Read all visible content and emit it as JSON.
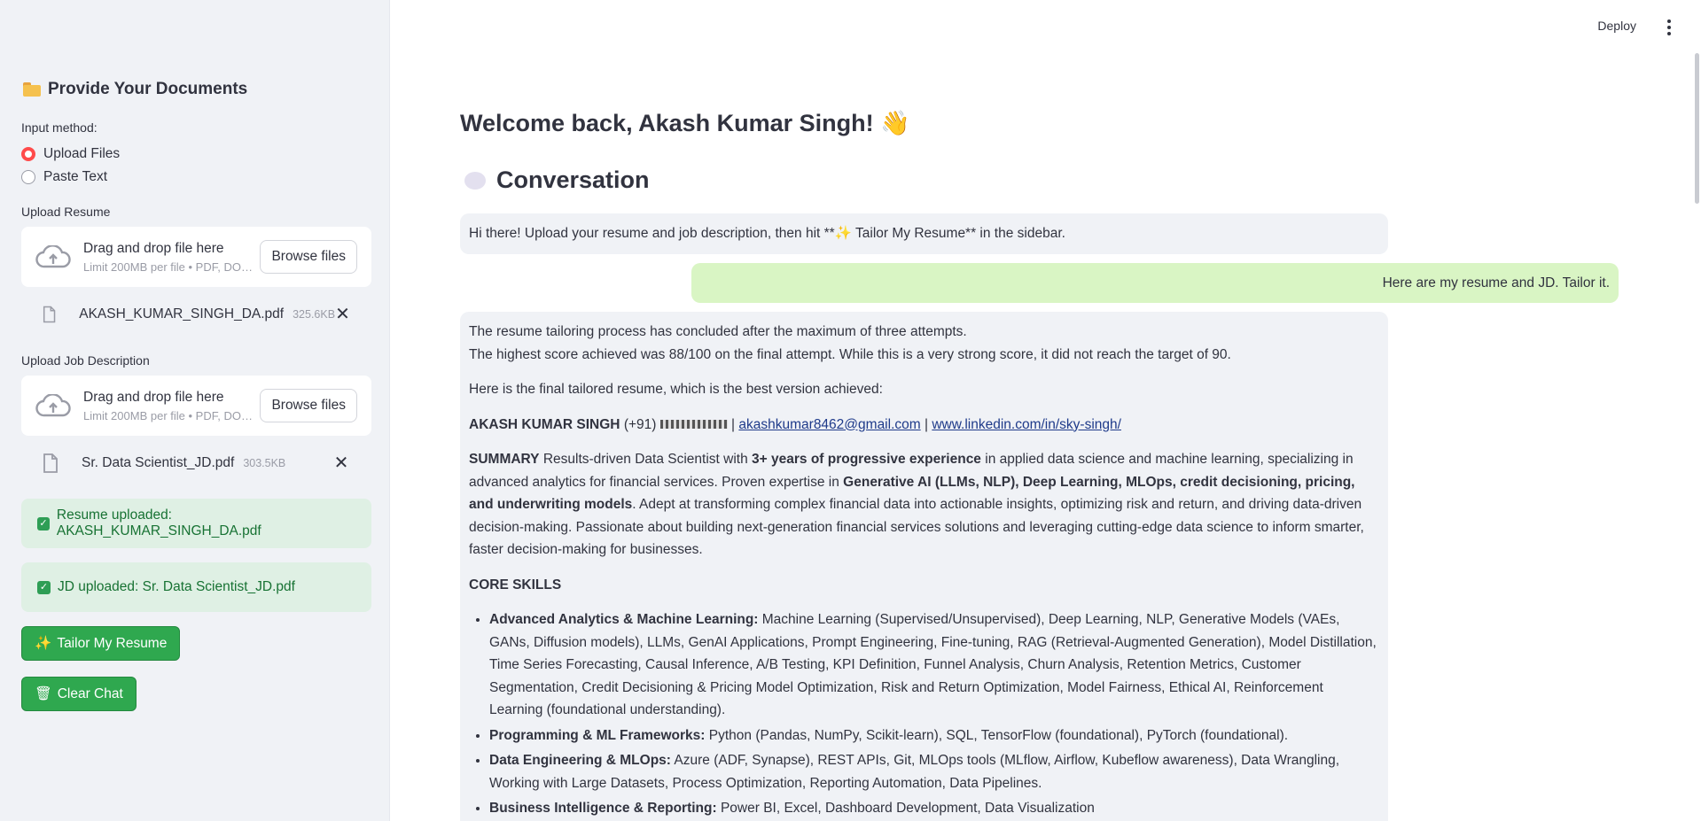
{
  "sidebar": {
    "title": "Provide Your Documents",
    "input_method_label": "Input method:",
    "radio_options": [
      {
        "label": "Upload Files",
        "selected": true
      },
      {
        "label": "Paste Text",
        "selected": false
      }
    ],
    "resume_label": "Upload Resume",
    "jd_label": "Upload Job Description",
    "dropzone": {
      "main": "Drag and drop file here",
      "sub": "Limit 200MB per file • PDF, DO…",
      "browse": "Browse files"
    },
    "resume_file": {
      "name": "AKASH_KUMAR_SINGH_DA.pdf",
      "size": "325.6KB"
    },
    "jd_file": {
      "name": "Sr. Data Scientist_JD.pdf",
      "size": "303.5KB"
    },
    "success_resume": "Resume uploaded: AKASH_KUMAR_SINGH_DA.pdf",
    "success_jd": "JD uploaded: Sr. Data Scientist_JD.pdf",
    "tailor_button": "Tailor My Resume",
    "clear_button": "Clear Chat"
  },
  "header": {
    "deploy": "Deploy"
  },
  "main": {
    "welcome": "Welcome back, Akash Kumar Singh! 👋",
    "conversation_title": "Conversation",
    "assistant_msg_1": "Hi there! Upload your resume and job description, then hit **✨ Tailor My Resume** in the sidebar.",
    "user_msg_1": "Here are my resume and JD. Tailor it.",
    "assistant_msg_2": {
      "line1": "The resume tailoring process has concluded after the maximum of three attempts.",
      "line2": "The highest score achieved was 88/100 on the final attempt. While this is a very strong score, it did not reach the target of 90.",
      "intro": "Here is the final tailored resume, which is the best version achieved:",
      "name": "AKASH KUMAR SINGH",
      "phone_prefix": "(+91)",
      "email": "akashkumar8462@gmail.com",
      "linkedin": "www.linkedin.com/in/sky-singh/",
      "summary_label": "SUMMARY",
      "summary_1": "Results-driven Data Scientist with",
      "summary_b1": "3+ years of progressive experience",
      "summary_2": "in applied data science and machine learning, specializing in advanced analytics for financial services. Proven expertise in",
      "summary_b2": "Generative AI (LLMs, NLP), Deep Learning, MLOps, credit decisioning, pricing, and underwriting models",
      "summary_3": ". Adept at transforming complex financial data into actionable insights, optimizing risk and return, and driving data-driven decision-making. Passionate about building next-generation financial services solutions and leveraging cutting-edge data science to inform smarter, faster decision-making for businesses.",
      "core_skills": "CORE SKILLS",
      "skills": [
        {
          "label": "Advanced Analytics & Machine Learning:",
          "text": " Machine Learning (Supervised/Unsupervised), Deep Learning, NLP, Generative Models (VAEs, GANs, Diffusion models), LLMs, GenAI Applications, Prompt Engineering, Fine-tuning, RAG (Retrieval-Augmented Generation), Model Distillation, Time Series Forecasting, Causal Inference, A/B Testing, KPI Definition, Funnel Analysis, Churn Analysis, Retention Metrics, Customer Segmentation, Credit Decisioning & Pricing Model Optimization, Risk and Return Optimization, Model Fairness, Ethical AI, Reinforcement Learning (foundational understanding)."
        },
        {
          "label": "Programming & ML Frameworks:",
          "text": " Python (Pandas, NumPy, Scikit-learn), SQL, TensorFlow (foundational), PyTorch (foundational)."
        },
        {
          "label": "Data Engineering & MLOps:",
          "text": " Azure (ADF, Synapse), REST APIs, Git, MLOps tools (MLflow, Airflow, Kubeflow awareness), Data Wrangling, Working with Large Datasets, Process Optimization, Reporting Automation, Data Pipelines."
        },
        {
          "label": "Business Intelligence & Reporting:",
          "text": " Power BI, Excel, Dashboard Development, Data Visualization"
        }
      ]
    }
  }
}
